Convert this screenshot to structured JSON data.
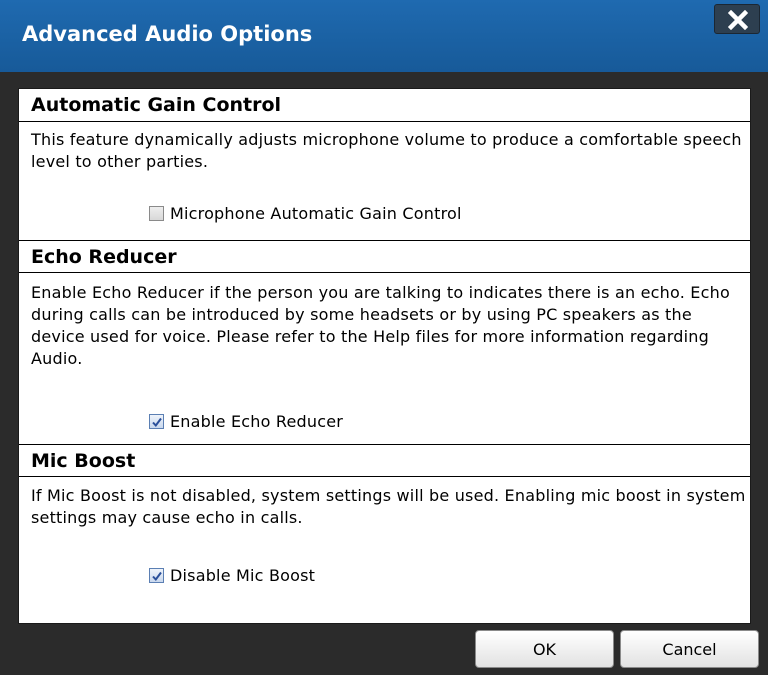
{
  "dialog": {
    "title": "Advanced Audio Options",
    "close_icon": "close-x-icon"
  },
  "sections": [
    {
      "heading": "Automatic Gain Control",
      "description": "This feature dynamically adjusts microphone volume to produce a comfortable speech level to other parties.",
      "checkbox_label": "Microphone Automatic Gain Control",
      "checked": false
    },
    {
      "heading": "Echo Reducer",
      "description": "Enable Echo Reducer if the person you are talking to indicates there is an echo. Echo during calls can be introduced by some headsets or by using PC speakers as the device used for voice. Please refer to the Help files for more information regarding Audio.",
      "checkbox_label": "Enable Echo Reducer",
      "checked": true
    },
    {
      "heading": "Mic Boost",
      "description": "If Mic Boost is not disabled, system settings will be used. Enabling mic boost in system settings may cause echo in calls.",
      "checkbox_label": "Disable Mic Boost",
      "checked": true
    }
  ],
  "footer": {
    "ok_label": "OK",
    "cancel_label": "Cancel"
  },
  "colors": {
    "titlebar": "#1b63a6",
    "frame": "#2b2b2b",
    "close_button": "#2d3f50"
  }
}
